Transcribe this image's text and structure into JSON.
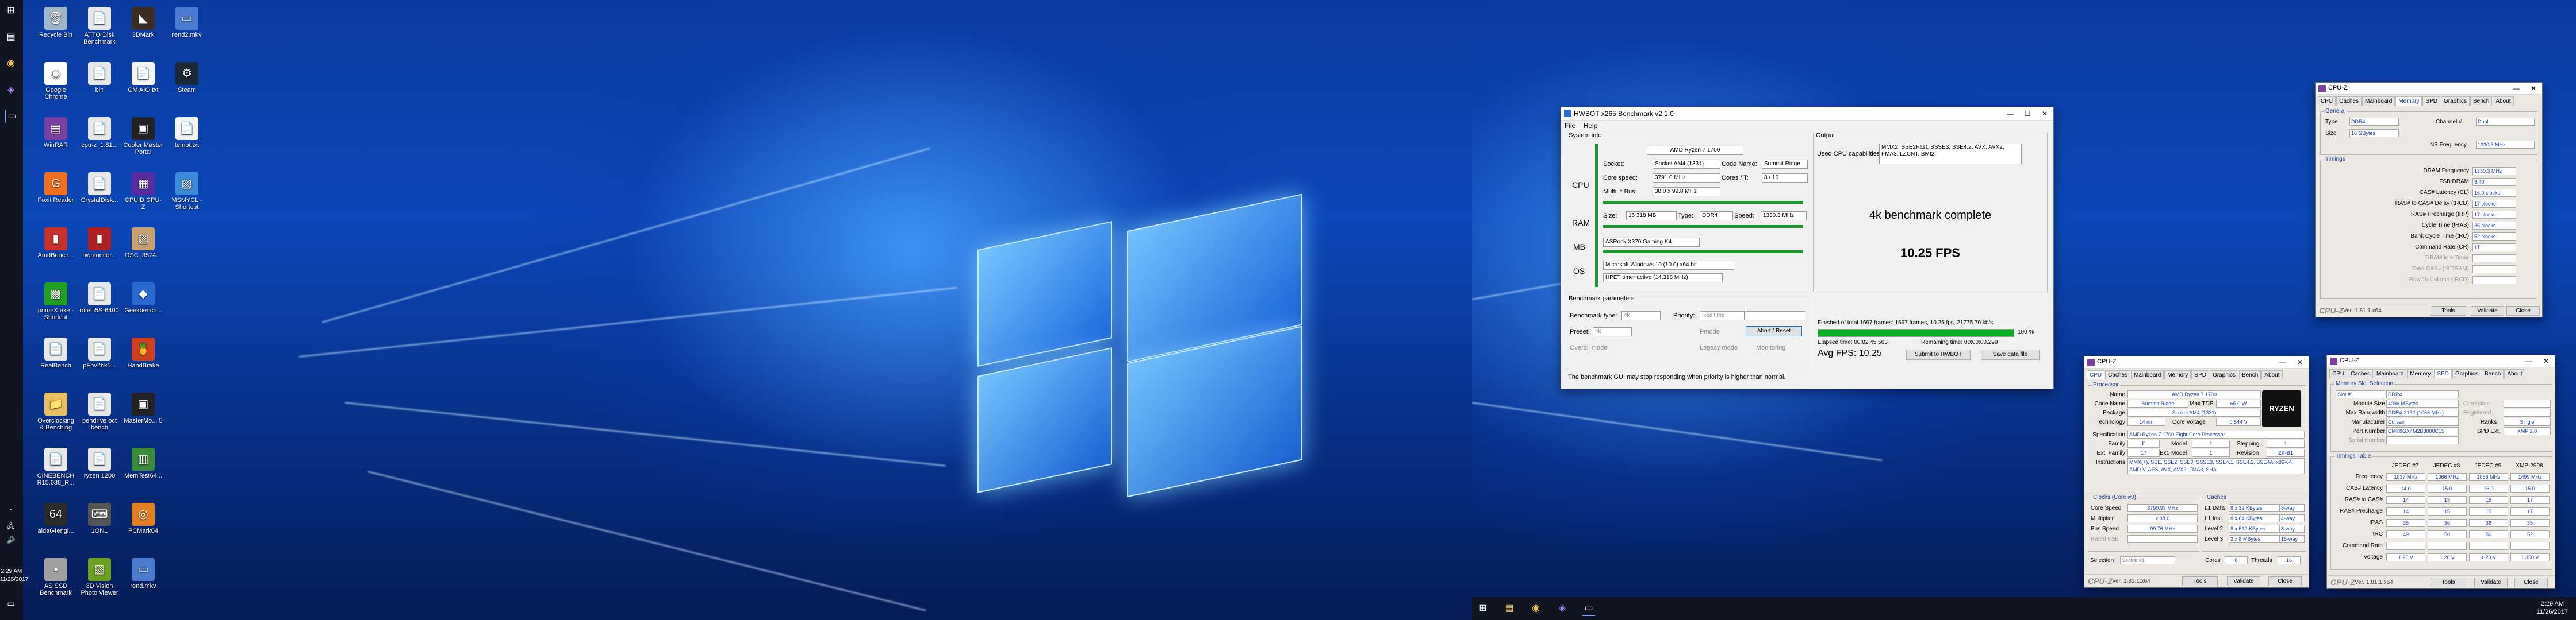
{
  "left_taskbar": {
    "clock_time": "2:29 AM",
    "clock_date": "11/26/2017"
  },
  "desktop_icons": [
    {
      "label": "Recycle Bin",
      "icon": "recycle-bin-icon",
      "color": "#9fb6c8",
      "glyph": "🗑"
    },
    {
      "label": "ATTO Disk Benchmark",
      "icon": "file-icon",
      "color": "#e8e8e8",
      "glyph": "📄"
    },
    {
      "label": "3DMark",
      "icon": "3dmark-icon",
      "color": "#3d2c22",
      "glyph": "◣"
    },
    {
      "label": "rend2.mkv",
      "icon": "video-icon",
      "color": "#4a7ad0",
      "glyph": "▭"
    },
    {
      "label": "Google Chrome",
      "icon": "chrome-icon",
      "color": "#ffffff",
      "glyph": "◉"
    },
    {
      "label": "bin",
      "icon": "file-icon",
      "color": "#e8e8e8",
      "glyph": "📄"
    },
    {
      "label": "CM AIO.txt",
      "icon": "text-file-icon",
      "color": "#f4f4f4",
      "glyph": "📄"
    },
    {
      "label": "Steam",
      "icon": "steam-icon",
      "color": "#1b2838",
      "glyph": "⚙"
    },
    {
      "label": "WinRAR",
      "icon": "winrar-icon",
      "color": "#7a3fa0",
      "glyph": "▤"
    },
    {
      "label": "cpu-z_1.81...",
      "icon": "file-icon",
      "color": "#e8e8e8",
      "glyph": "📄"
    },
    {
      "label": "Cooler Master Portal",
      "icon": "cooler-master-icon",
      "color": "#222222",
      "glyph": "▣"
    },
    {
      "label": "tempt.txt",
      "icon": "text-file-icon",
      "color": "#f4f4f4",
      "glyph": "📄"
    },
    {
      "label": "Foxit Reader",
      "icon": "foxit-icon",
      "color": "#f07020",
      "glyph": "G"
    },
    {
      "label": "CrystalDisk...",
      "icon": "file-icon",
      "color": "#e8e8e8",
      "glyph": "📄"
    },
    {
      "label": "CPUID CPU-Z",
      "icon": "cpuz-icon",
      "color": "#5a2aa0",
      "glyph": "▦"
    },
    {
      "label": "MSMYCL - Shortcut",
      "icon": "shortcut-icon",
      "color": "#3a8ad8",
      "glyph": "▨"
    },
    {
      "label": "AmdBench...",
      "icon": "amdbench-icon",
      "color": "#c8302a",
      "glyph": "▮"
    },
    {
      "label": "hwmonitor...",
      "icon": "hwmonitor-icon",
      "color": "#b02020",
      "glyph": "▮"
    },
    {
      "label": "DSC_3574...",
      "icon": "photo-icon",
      "color": "#c8a070",
      "glyph": "▧"
    },
    {
      "label": "primeX.exe - Shortcut",
      "icon": "prime95-icon",
      "color": "#20a020",
      "glyph": "▩"
    },
    {
      "label": "intel i5S-6400",
      "icon": "file-icon",
      "color": "#e8e8e8",
      "glyph": "📄"
    },
    {
      "label": "Geekbench...",
      "icon": "geekbench-icon",
      "color": "#2a6ad0",
      "glyph": "◆"
    },
    {
      "label": "RealBench",
      "icon": "file-icon",
      "color": "#e8e8e8",
      "glyph": "📄"
    },
    {
      "label": "pFhv2hk5...",
      "icon": "file-icon",
      "color": "#e8e8e8",
      "glyph": "📄"
    },
    {
      "label": "HandBrake",
      "icon": "handbrake-icon",
      "color": "#d04020",
      "glyph": "🍍"
    },
    {
      "label": "Overclocking & Benching",
      "icon": "folder-icon",
      "color": "#e8c060",
      "glyph": "📁"
    },
    {
      "label": "pendrive oct bench",
      "icon": "file-icon",
      "color": "#e8e8e8",
      "glyph": "📄"
    },
    {
      "label": "MasterMo... 5",
      "icon": "cooler-master-icon",
      "color": "#222222",
      "glyph": "▣"
    },
    {
      "label": "CINEBENCH R15.038_R...",
      "icon": "file-icon",
      "color": "#e8e8e8",
      "glyph": "📄"
    },
    {
      "label": "ryzen 1200",
      "icon": "file-icon",
      "color": "#e8e8e8",
      "glyph": "📄"
    },
    {
      "label": "MemTest64...",
      "icon": "memtest-icon",
      "color": "#3a8a3a",
      "glyph": "▥"
    },
    {
      "label": "aida64engi...",
      "icon": "aida64-icon",
      "color": "#2a2a2a",
      "glyph": "64"
    },
    {
      "label": "1ON1",
      "icon": "keyboard-icon",
      "color": "#555555",
      "glyph": "⌨"
    },
    {
      "label": "PCMark04",
      "icon": "pcmark-icon",
      "color": "#e08020",
      "glyph": "◎"
    },
    {
      "label": "AS SSD Benchmark",
      "icon": "as-ssd-icon",
      "color": "#a0a0a0",
      "glyph": "▪"
    },
    {
      "label": "3D Vision Photo Viewer",
      "icon": "photo-viewer-icon",
      "color": "#6aa020",
      "glyph": "▧"
    },
    {
      "label": "rend.mkv",
      "icon": "video-icon",
      "color": "#4a7ad0",
      "glyph": "▭"
    }
  ],
  "right_taskbar": {
    "time": "2:29 AM",
    "date": "11/26/2017"
  },
  "hwbot": {
    "title": "HWBOT x265 Benchmark v2.1.0",
    "menu": [
      "File",
      "Help"
    ],
    "system_info": "System info",
    "cpu_label": "CPU",
    "ram_label": "RAM",
    "mb_label": "MB",
    "os_label": "OS",
    "cpu_name": "AMD Ryzen 7 1700",
    "socket_label": "Socket:",
    "socket_value": "Socket AM4 (1331)",
    "codename_label": "Code Name:",
    "codename_value": "Summit Ridge",
    "corespeed_label": "Core speed:",
    "corespeed_value": "3791.0 MHz",
    "cores_label": "Cores / T:",
    "cores_value": "8 / 16",
    "multi_label": "Multi. * Bus:",
    "multi_value": "38.0 x 99.8 MHz",
    "size_label": "Size:",
    "size_value": "16 318 MB",
    "type_label": "Type:",
    "type_value": "DDR4",
    "speed_label": "Speed:",
    "speed_value": "1330.3 MHz",
    "mb_value": "ASRock X370 Gaming K4",
    "os_value": "Microsoft Windows 10 (10.0) x64 bit",
    "timer_value": "HPET timer active (14.318 MHz)",
    "output_label": "Output",
    "capabilities_label": "Used CPU capabilities:",
    "capabilities_value": "MMX2, SSE2Fast, SSSE3, SSE4.2, AVX, AVX2, FMA3, LZCNT, BMI2",
    "result_heading": "4k benchmark complete",
    "result_fps": "10.25 FPS",
    "params_label": "Benchmark parameters",
    "benchtype_label": "Benchmark type:",
    "benchtype_value": "4k",
    "priority_label": "Priority:",
    "priority_value": "Realtime",
    "preset_label": "Preset:",
    "preset_value": "4k",
    "pmode_label": "Pmode",
    "overall_mode_label": "Overall mode",
    "legacy_mode_label": "Legacy mode",
    "monitoring_label": "Monitoring",
    "abort_label": "Abort / Reset",
    "finished_text": "Finished of total 1697 frames: 1697 frames, 10.25 fps, 21775.70 kb/s",
    "progress_label": "100 %",
    "progress_fraction": 1.0,
    "elapsed_text": "Elapsed time: 00:02:45.563",
    "remaining_text": "Remaining time: 00:00:00.299",
    "avg_fps": "Avg FPS: 10.25",
    "submit_label": "Submit to HWBOT",
    "save_label": "Save data file",
    "footer_note": "The benchmark GUI may stop responding when priority is higher than normal."
  },
  "cpuz_memory": {
    "title": "CPU-Z",
    "tabs": [
      "CPU",
      "Caches",
      "Mainboard",
      "Memory",
      "SPD",
      "Graphics",
      "Bench",
      "About"
    ],
    "active_tab": "Memory",
    "general": "General",
    "type_label": "Type",
    "type_value": "DDR4",
    "channel_label": "Channel #",
    "channel_value": "Dual",
    "size_label": "Size",
    "size_value": "16 GBytes",
    "nbfreq_label": "NB Frequency",
    "nbfreq_value": "1330.3 MHz",
    "timings": "Timings",
    "rows": [
      {
        "label": "DRAM Frequency",
        "value": "1330.3 MHz"
      },
      {
        "label": "FSB:DRAM",
        "value": "3:40"
      },
      {
        "label": "CAS# Latency (CL)",
        "value": "16.0 clocks"
      },
      {
        "label": "RAS# to CAS# Delay (tRCD)",
        "value": "17 clocks"
      },
      {
        "label": "RAS# Precharge (tRP)",
        "value": "17 clocks"
      },
      {
        "label": "Cycle Time (tRAS)",
        "value": "35 clocks"
      },
      {
        "label": "Bank Cycle Time (tRC)",
        "value": "52 clocks"
      },
      {
        "label": "Command Rate (CR)",
        "value": "1T"
      },
      {
        "label": "DRAM Idle Timer",
        "value": ""
      },
      {
        "label": "Total CAS# (tRDRAM)",
        "value": ""
      },
      {
        "label": "Row To Column (tRCD)",
        "value": ""
      }
    ],
    "brand": "CPU-Z",
    "version": "Ver. 1.81.1.x64",
    "tools_label": "Tools",
    "validate_label": "Validate",
    "close_label": "Close"
  },
  "cpuz_cpu": {
    "title": "CPU-Z",
    "tabs": [
      "CPU",
      "Caches",
      "Mainboard",
      "Memory",
      "SPD",
      "Graphics",
      "Bench",
      "About"
    ],
    "active_tab": "CPU",
    "processor": "Processor",
    "name_label": "Name",
    "name_value": "AMD Ryzen 7 1700",
    "codename_label": "Code Name",
    "codename_value": "Summit Ridge",
    "maxtdp_label": "Max TDP",
    "maxtdp_value": "65.0 W",
    "package_label": "Package",
    "package_value": "Socket AM4 (1331)",
    "technology_label": "Technology",
    "technology_value": "14 nm",
    "corevoltage_label": "Core Voltage",
    "corevoltage_value": "0.544 V",
    "spec_label": "Specification",
    "spec_value": "AMD Ryzen 7 1700 Eight-Core Processor",
    "family_label": "Family",
    "family_value": "F",
    "model_label": "Model",
    "model_value": "1",
    "stepping_label": "Stepping",
    "stepping_value": "1",
    "extfamily_label": "Ext. Family",
    "extfamily_value": "17",
    "extmodel_label": "Ext. Model",
    "extmodel_value": "1",
    "revision_label": "Revision",
    "revision_value": "ZP-B1",
    "instructions_label": "Instructions",
    "instructions_value": "MMX(+), SSE, SSE2, SSE3, SSSE3, SSE4.1, SSE4.2, SSE4A, x86-64, AMD-V, AES, AVX, AVX2, FMA3, SHA",
    "clocks": "Clocks (Core #0)",
    "caches": "Caches",
    "corespeed_label": "Core Speed",
    "corespeed_value": "3790.93 MHz",
    "multiplier_label": "Multiplier",
    "multiplier_value": "x 38.0",
    "busspeed_label": "Bus Speed",
    "busspeed_value": "99.76 MHz",
    "ratedfsb_label": "Rated FSB",
    "l1d_label": "L1 Data",
    "l1d_value": "8 x 32 KBytes",
    "l1d_way": "8-way",
    "l1i_label": "L1 Inst.",
    "l1i_value": "8 x 64 KBytes",
    "l1i_way": "4-way",
    "l2_label": "Level 2",
    "l2_value": "8 x 512 KBytes",
    "l2_way": "8-way",
    "l3_label": "Level 3",
    "l3_value": "2 x 8 MBytes",
    "l3_way": "16-way",
    "selection_label": "Selection",
    "selection_value": "Socket #1",
    "cores_label": "Cores",
    "cores_value": "8",
    "threads_label": "Threads",
    "threads_value": "16",
    "logo_text": "RYZEN",
    "brand": "CPU-Z",
    "version": "Ver. 1.81.1.x64",
    "tools_label": "Tools",
    "validate_label": "Validate",
    "close_label": "Close"
  },
  "cpuz_spd": {
    "title": "CPU-Z",
    "tabs": [
      "CPU",
      "Caches",
      "Mainboard",
      "Memory",
      "SPD",
      "Graphics",
      "Bench",
      "About"
    ],
    "active_tab": "SPD",
    "slot_section": "Memory Slot Selection",
    "slot_value": "Slot #1",
    "slot_type": "DDR4",
    "module_size_label": "Module Size",
    "module_size_value": "4096 MBytes",
    "max_bw_label": "Max Bandwidth",
    "max_bw_value": "DDR4-2132 (1066 MHz)",
    "manufacturer_label": "Manufacturer",
    "manufacturer_value": "Corsair",
    "part_label": "Part Number",
    "part_value": "CMK8GX4M2B3000C15",
    "serial_label": "Serial Number",
    "correction_label": "Correction",
    "registered_label": "Registered",
    "ranks_label": "Ranks",
    "ranks_value": "Single",
    "spdext_label": "SPD Ext.",
    "spdext_value": "XMP 2.0",
    "timings_table": "Timings Table",
    "columns": [
      "",
      "JEDEC #7",
      "JEDEC #8",
      "JEDEC #9",
      "XMP-2998"
    ],
    "table_rows": [
      {
        "label": "Frequency",
        "cells": [
          "1037 MHz",
          "1066 MHz",
          "1066 MHz",
          "1499 MHz"
        ]
      },
      {
        "label": "CAS# Latency",
        "cells": [
          "14.0",
          "15.0",
          "16.0",
          "15.0"
        ]
      },
      {
        "label": "RAS# to CAS#",
        "cells": [
          "14",
          "15",
          "15",
          "17"
        ]
      },
      {
        "label": "RAS# Precharge",
        "cells": [
          "14",
          "15",
          "15",
          "17"
        ]
      },
      {
        "label": "tRAS",
        "cells": [
          "35",
          "36",
          "36",
          "35"
        ]
      },
      {
        "label": "tRC",
        "cells": [
          "49",
          "50",
          "50",
          "52"
        ]
      },
      {
        "label": "Command Rate",
        "cells": [
          "",
          "",
          "",
          ""
        ]
      },
      {
        "label": "Voltage",
        "cells": [
          "1.20 V",
          "1.20 V",
          "1.20 V",
          "1.350 V"
        ]
      }
    ],
    "brand": "CPU-Z",
    "version": "Ver. 1.81.1.x64",
    "tools_label": "Tools",
    "validate_label": "Validate",
    "close_label": "Close"
  }
}
